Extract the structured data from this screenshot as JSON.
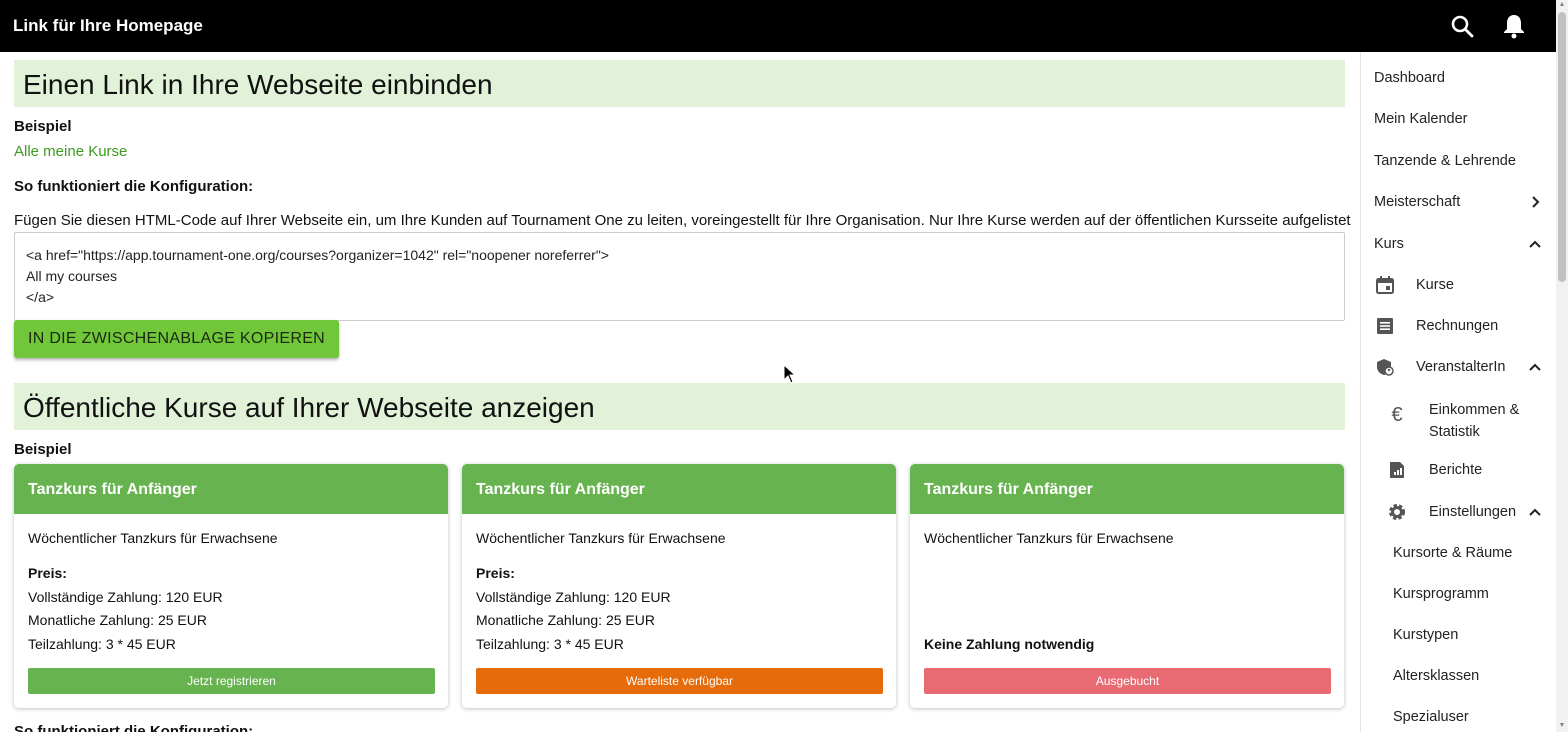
{
  "topbar": {
    "title": "Link für Ihre Homepage",
    "icons": [
      "search-icon",
      "bell-icon"
    ]
  },
  "section1": {
    "heading": "Einen Link in Ihre Webseite einbinden",
    "example_label": "Beispiel",
    "example_link": "Alle meine Kurse",
    "config_label": "So funktioniert die Konfiguration:",
    "config_text": "Fügen Sie diesen HTML-Code auf Ihrer Webseite ein, um Ihre Kunden auf Tournament One zu leiten, voreingestellt für Ihre Organisation. Nur Ihre Kurse werden auf der öffentlichen Kursseite aufgelistet",
    "code_lines": [
      "<a href=\"https://app.tournament-one.org/courses?organizer=1042\" rel=\"noopener noreferrer\">",
      "All my courses",
      "</a>"
    ],
    "copy_button": "IN DIE ZWISCHENABLAGE KOPIEREN"
  },
  "section2": {
    "heading": "Öffentliche Kurse auf Ihrer Webseite anzeigen",
    "example_label": "Beispiel",
    "config_label_partial": "So funktioniert die Konfiguration:",
    "cards": [
      {
        "title": "Tanzkurs für Anfänger",
        "description": "Wöchentlicher Tanzkurs für Erwachsene",
        "price_label": "Preis:",
        "price_lines": [
          "Vollständige Zahlung: 120 EUR",
          "Monatliche Zahlung: 25 EUR",
          "Teilzahlung: 3 * 45 EUR"
        ],
        "button": "Jetzt registrieren",
        "button_color": "#66b34f"
      },
      {
        "title": "Tanzkurs für Anfänger",
        "description": "Wöchentlicher Tanzkurs für Erwachsene",
        "price_label": "Preis:",
        "price_lines": [
          "Vollständige Zahlung: 120 EUR",
          "Monatliche Zahlung: 25 EUR",
          "Teilzahlung: 3 * 45 EUR"
        ],
        "button": "Warteliste verfügbar",
        "button_color": "#e56b0b"
      },
      {
        "title": "Tanzkurs für Anfänger",
        "description": "Wöchentlicher Tanzkurs für Erwachsene",
        "no_payment": "Keine Zahlung notwendig",
        "button": "Ausgebucht",
        "button_color": "#e86b74"
      }
    ]
  },
  "sidebar": {
    "items": [
      {
        "label": "Dashboard"
      },
      {
        "label": "Mein Kalender"
      },
      {
        "label": "Tanzende & Lehrende"
      },
      {
        "label": "Meisterschaft",
        "chevron": "chevron-right-icon"
      },
      {
        "label": "Kurs",
        "chevron": "chevron-up-icon"
      },
      {
        "label": "Kurse",
        "icon": "calendar-icon"
      },
      {
        "label": "Rechnungen",
        "icon": "receipt-icon"
      },
      {
        "label": "VeranstalterIn",
        "icon": "shield-user-icon",
        "chevron": "chevron-up-icon"
      },
      {
        "label": "Einkommen & Statistik",
        "icon": "euro-icon"
      },
      {
        "label": "Berichte",
        "icon": "report-icon"
      },
      {
        "label": "Einstellungen",
        "icon": "gear-icon",
        "chevron": "chevron-up-icon"
      },
      {
        "label": "Kursorte & Räume"
      },
      {
        "label": "Kursprogramm"
      },
      {
        "label": "Kurstypen"
      },
      {
        "label": "Altersklassen"
      },
      {
        "label": "Spezialuser"
      }
    ]
  },
  "colors": {
    "topbar": "#000000",
    "section_bg": "#e2f2d9",
    "accent_green": "#71c63a",
    "card_header": "#66b34f",
    "link": "#3c9a1f"
  }
}
